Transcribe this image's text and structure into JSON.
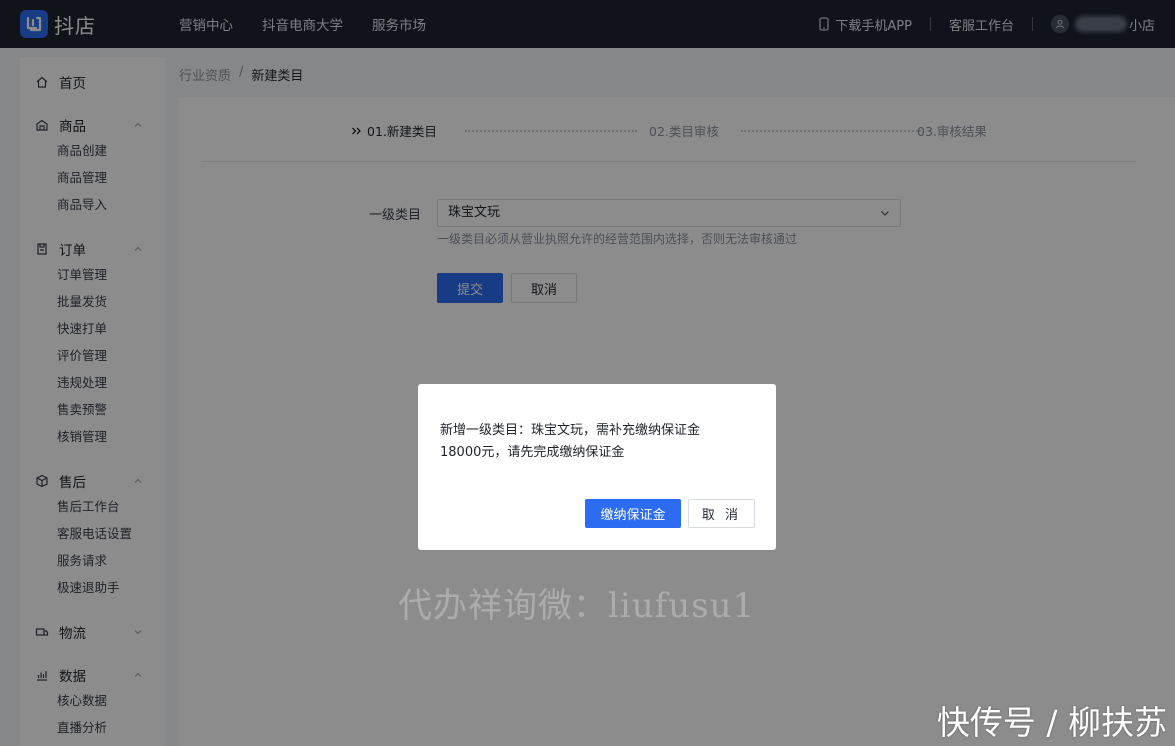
{
  "topbar": {
    "logo_text": "抖店",
    "nav": [
      "营销中心",
      "抖音电商大学",
      "服务市场"
    ],
    "download_app": "下载手机APP",
    "service_desk": "客服工作台",
    "shop_name_suffix": "小店"
  },
  "sidebar": {
    "home": "首页",
    "groups": [
      {
        "label": "商品",
        "icon": "product-icon",
        "expanded": true,
        "items": [
          "商品创建",
          "商品管理",
          "商品导入"
        ]
      },
      {
        "label": "订单",
        "icon": "order-icon",
        "expanded": true,
        "items": [
          "订单管理",
          "批量发货",
          "快速打单",
          "评价管理",
          "违规处理",
          "售卖预警",
          "核销管理"
        ]
      },
      {
        "label": "售后",
        "icon": "after-sales-icon",
        "expanded": true,
        "items": [
          "售后工作台",
          "客服电话设置",
          "服务请求",
          "极速退助手"
        ]
      },
      {
        "label": "物流",
        "icon": "logistics-icon",
        "expanded": false,
        "items": []
      },
      {
        "label": "数据",
        "icon": "data-icon",
        "expanded": true,
        "items": [
          "核心数据",
          "直播分析"
        ]
      }
    ]
  },
  "breadcrumb": {
    "parent": "行业资质",
    "separator": "/",
    "current": "新建类目"
  },
  "steps": [
    "01.新建类目",
    "02.类目审核",
    "03.审核结果"
  ],
  "form": {
    "label": "一级类目",
    "value": "珠宝文玩",
    "help": "一级类目必须从营业执照允许的经营范围内选择，否则无法审核通过",
    "submit": "提交",
    "cancel": "取消"
  },
  "modal": {
    "line1": "新增一级类目：珠宝文玩，需补充缴纳保证金",
    "line2": "18000元，请先完成缴纳保证金",
    "confirm": "缴纳保证金",
    "cancel": "取 消"
  },
  "watermarks": {
    "center": "代办祥询微：liufusu1",
    "corner": "快传号 / 柳扶苏"
  },
  "colors": {
    "accent": "#2b6cf3",
    "topbar_bg": "#1e2431"
  }
}
